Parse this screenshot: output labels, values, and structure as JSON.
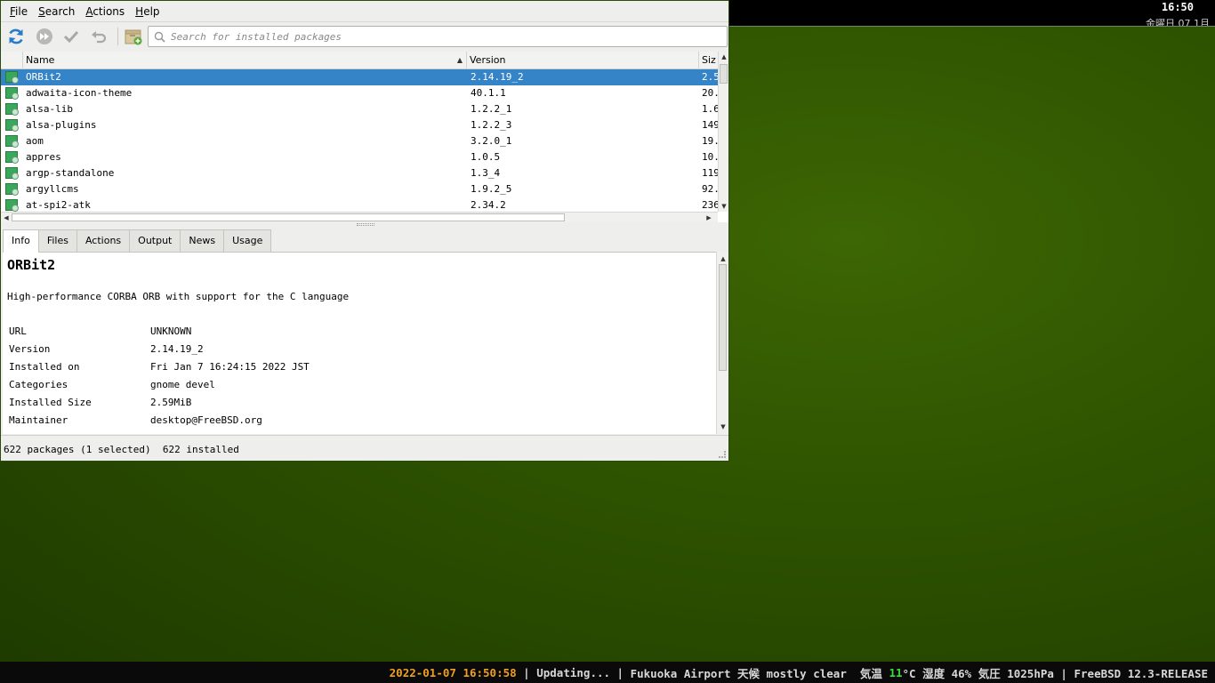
{
  "topbar": {
    "time": "16:50",
    "date": "金曜日 07 1月"
  },
  "statusbar": {
    "datetime": "2022-01-07 16:50:58",
    "sep1": " | ",
    "updating": "Updating...",
    "sep2": " | ",
    "weather_prefix": "Fukuoka Airport 天候 mostly clear  気温 ",
    "temperature": "11",
    "weather_suffix": "°C 湿度 46% 気圧 1025hPa | FreeBSD 12.3-RELEASE"
  },
  "menubar": {
    "file": "File",
    "search": "Search",
    "actions": "Actions",
    "help": "Help"
  },
  "toolbar": {
    "search_placeholder": "Search for installed packages",
    "accent": "#2a7acb"
  },
  "table": {
    "columns": {
      "name": "Name",
      "version": "Version",
      "size": "Siz"
    },
    "rows": [
      {
        "name": "ORBit2",
        "version": "2.14.19_2",
        "size": "2.5"
      },
      {
        "name": "adwaita-icon-theme",
        "version": "40.1.1",
        "size": "20."
      },
      {
        "name": "alsa-lib",
        "version": "1.2.2_1",
        "size": "1.6"
      },
      {
        "name": "alsa-plugins",
        "version": "1.2.2_3",
        "size": "149"
      },
      {
        "name": "aom",
        "version": "3.2.0_1",
        "size": "19."
      },
      {
        "name": "appres",
        "version": "1.0.5",
        "size": "10."
      },
      {
        "name": "argp-standalone",
        "version": "1.3_4",
        "size": "119"
      },
      {
        "name": "argyllcms",
        "version": "1.9.2_5",
        "size": "92."
      },
      {
        "name": "at-spi2-atk",
        "version": "2.34.2",
        "size": "236"
      }
    ]
  },
  "tabs": [
    "Info",
    "Files",
    "Actions",
    "Output",
    "News",
    "Usage"
  ],
  "info": {
    "title": "ORBit2",
    "description": "High-performance CORBA ORB with support for the C language",
    "fields": [
      {
        "label": "URL",
        "value": "UNKNOWN"
      },
      {
        "label": "Version",
        "value": "2.14.19_2"
      },
      {
        "label": "Installed on",
        "value": "Fri Jan 7 16:24:15 2022 JST"
      },
      {
        "label": "Categories",
        "value": "gnome devel"
      },
      {
        "label": "Installed Size",
        "value": "2.59MiB"
      },
      {
        "label": "Maintainer",
        "value": "desktop@FreeBSD.org"
      }
    ]
  },
  "window_status": {
    "packages": "622 packages (1 selected)",
    "installed": "622 installed"
  }
}
